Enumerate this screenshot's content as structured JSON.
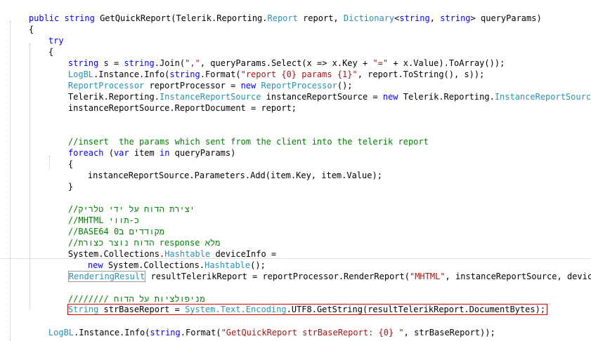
{
  "code": {
    "l1": {
      "kw1": "public",
      "kw2": "string",
      "t1": " GetQuickReport(Telerik.Reporting.",
      "ty1": "Report",
      "t2": " report, ",
      "ty2": "Dictionary",
      "t3": "<",
      "kw3": "string",
      "t4": ", ",
      "kw4": "string",
      "t5": "> queryParams)"
    },
    "l2": {
      "t": "{"
    },
    "l3": {
      "kw": "try"
    },
    "l4": {
      "t": "{"
    },
    "l5": {
      "kw1": "string",
      "t1": " s = ",
      "kw2": "string",
      "t2": ".Join(",
      "st1": "\",\"",
      "t3": ", queryParams.Select(x => x.Key + ",
      "st2": "\"=\"",
      "t4": " + x.Value).ToArray());"
    },
    "l6": {
      "ty1": "LogBL",
      "t1": ".Instance.Info(",
      "kw1": "string",
      "t2": ".Format(",
      "st1": "\"report {0} params {1}\"",
      "t3": ", report.ToString(), s));"
    },
    "l7": {
      "ty1": "ReportProcessor",
      "t1": " reportProcessor = ",
      "kw1": "new",
      "ty2": "ReportProcessor",
      "t2": "();"
    },
    "l8": {
      "t1": "Telerik.Reporting.",
      "ty1": "InstanceReportSource",
      "t2": " instanceReportSource = ",
      "kw1": "new",
      "t3": " Telerik.Reporting.",
      "ty2": "InstanceReportSource",
      "t4": "();"
    },
    "l9": {
      "t": "instanceReportSource.ReportDocument = report;"
    },
    "l10": {
      "cm": "//insert  the params which sent from the client into the telerik report"
    },
    "l11": {
      "kw1": "foreach",
      "t1": " (",
      "kw2": "var",
      "t2": " item ",
      "kw3": "in",
      "t3": " queryParams)"
    },
    "l12": {
      "t": "{"
    },
    "l13": {
      "t": "instanceReportSource.Parameters.Add(item.Key, item.Value);"
    },
    "l14": {
      "t": "}"
    },
    "l15": {
      "cm": "//יצירת הדוח על ידי טלריק"
    },
    "l16": {
      "cm": "//MHTML כ-תווי"
    },
    "l17": {
      "cm": "//BASE64 מקודדים ב0"
    },
    "l18": {
      "cm": "//הדוח נוצר כצורת response מלא"
    },
    "l19": {
      "t1": "System.Collections.",
      "ty1": "Hashtable",
      "t2": " deviceInfo ="
    },
    "l20": {
      "kw1": "new",
      "t1": " System.Collections.",
      "ty1": "Hashtable",
      "t2": "();"
    },
    "l21": {
      "ty1": "RenderingResult",
      "t1": " resultTelerikReport = reportProcessor.RenderReport(",
      "st1": "\"MHTML\"",
      "t2": ", instanceReportSource, deviceInfo);"
    },
    "l22": {
      "cm": "//////// מניפולציות על הדוח"
    },
    "l23": {
      "ty1": "String",
      "t1": " strBaseReport = ",
      "ty2": "System.Text.Encoding",
      "t2": ".UTF8.GetString(resultTelerikReport.DocumentBytes);"
    },
    "l24": {
      "ty1": "LogBL",
      "t1": ".Instance.Info(",
      "kw1": "string",
      "t2": ".Format(",
      "st1": "\"GetQuickReport strBaseReport: {0} \"",
      "t3": ", strBaseReport));"
    }
  }
}
